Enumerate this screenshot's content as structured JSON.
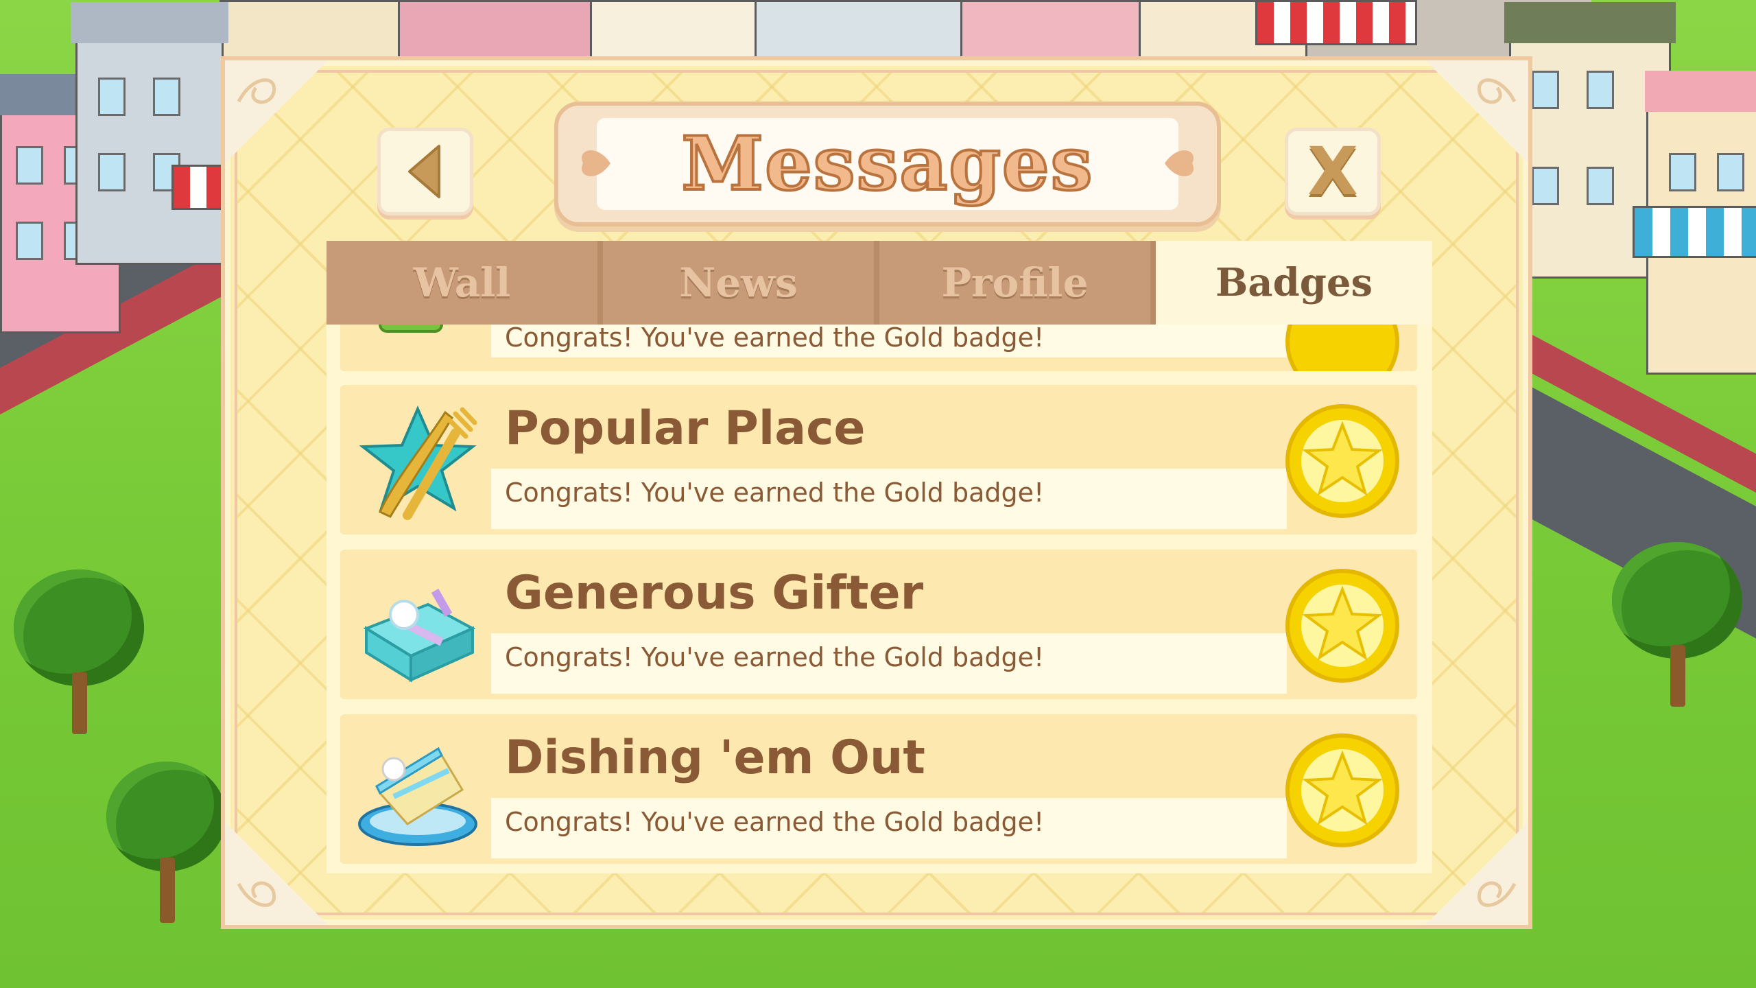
{
  "dialog": {
    "title": "Messages",
    "close_label": "X"
  },
  "tabs": [
    {
      "label": "Wall",
      "active": false
    },
    {
      "label": "News",
      "active": false
    },
    {
      "label": "Profile",
      "active": false
    },
    {
      "label": "Badges",
      "active": true
    }
  ],
  "badges": [
    {
      "title": "",
      "description": "Congrats! You've earned the Gold badge!",
      "icon": "green-badge-icon"
    },
    {
      "title": "Popular Place",
      "description": "Congrats! You've earned the Gold badge!",
      "icon": "star-fork-knife-icon"
    },
    {
      "title": "Generous Gifter",
      "description": "Congrats! You've earned the Gold badge!",
      "icon": "gift-box-icon"
    },
    {
      "title": "Dishing 'em Out",
      "description": "Congrats! You've earned the Gold badge!",
      "icon": "cake-plate-icon"
    }
  ],
  "colors": {
    "panel": "#fbeeb0",
    "tab_inactive": "#c79b77",
    "tab_active": "#fff7d9",
    "text_brown": "#8a5a36",
    "gold": "#f5d200"
  }
}
